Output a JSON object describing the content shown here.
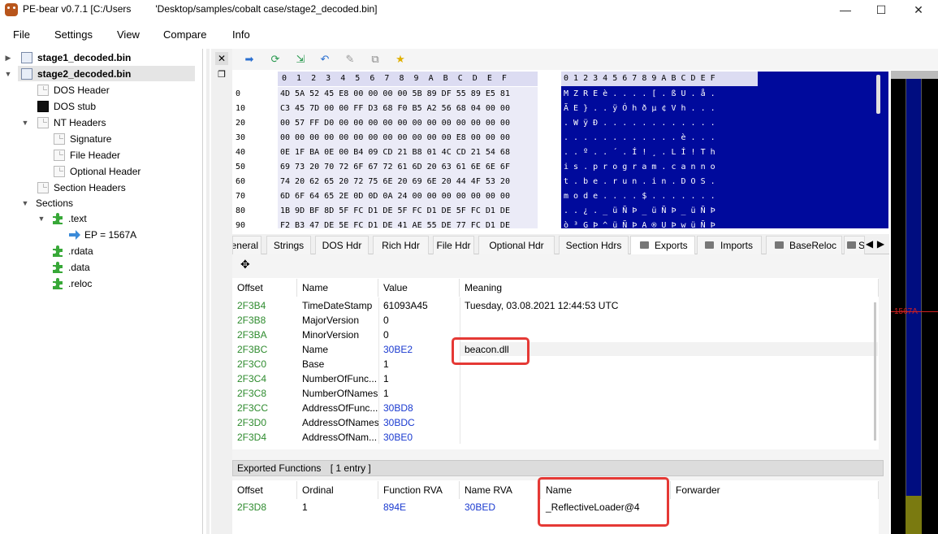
{
  "window": {
    "title": "PE-bear v0.7.1 [C:/Users         'Desktop/samples/cobalt case/stage2_decoded.bin]",
    "minimize": "—",
    "maximize": "☐",
    "close": "✕"
  },
  "menu": [
    "File",
    "Settings",
    "View",
    "Compare",
    "Info"
  ],
  "tree": {
    "files": [
      "stage1_decoded.bin",
      "stage2_decoded.bin"
    ],
    "nodes": [
      "DOS Header",
      "DOS stub",
      "NT Headers",
      "Signature",
      "File Header",
      "Optional Header",
      "Section Headers",
      "Sections",
      ".text",
      "EP = 1567A",
      ".rdata",
      ".data",
      ".reloc"
    ]
  },
  "hex": {
    "header": "0  1  2  3  4  5  6  7  8  9  A  B  C  D  E  F",
    "offsets": [
      "0",
      "10",
      "20",
      "30",
      "40",
      "50",
      "60",
      "70",
      "80",
      "90"
    ],
    "rows": [
      "4D 5A 52 45 E8 00 00 00 00 5B 89 DF 55 89 E5 81",
      "C3 45 7D 00 00 FF D3 68 F0 B5 A2 56 68 04 00 00",
      "00 57 FF D0 00 00 00 00 00 00 00 00 00 00 00 00",
      "00 00 00 00 00 00 00 00 00 00 00 00 E8 00 00 00",
      "0E 1F BA 0E 00 B4 09 CD 21 B8 01 4C CD 21 54 68",
      "69 73 20 70 72 6F 67 72 61 6D 20 63 61 6E 6E 6F",
      "74 20 62 65 20 72 75 6E 20 69 6E 20 44 4F 53 20",
      "6D 6F 64 65 2E 0D 0D 0A 24 00 00 00 00 00 00 00",
      "1B 9D BF 8D 5F FC D1 DE 5F FC D1 DE 5F FC D1 DE",
      "F2 B3 47 DE 5E FC D1 DE 41 AE 55 DE 77 FC D1 DE"
    ],
    "ascii_header": "0 1 2 3 4 5 6 7 8 9 A B C D E F",
    "ascii_rows": [
      "M Z R E è . . . . [ . ß U . å .",
      "Ã E } . . ÿ Ó h ð µ ¢ V h . . .",
      ". W ÿ Ð . . . . . . . . . . . .",
      ". . . . . . . . . . . . è . . .",
      ". . º . . ´ . Í ! ¸ . L Í ! T h",
      "i s . p r o g r a m . c a n n o",
      "t . b e . r u n . i n . D O S .",
      "m o d e . . . . $ . . . . . . .",
      ". . ¿ . _ ü Ñ Þ _ ü Ñ Þ _ ü Ñ Þ",
      "ò ³ G Þ ^ ü Ñ Þ A ® U Þ w ü Ñ Þ"
    ]
  },
  "rva_marker": "1567A",
  "tabs": [
    "General",
    "Strings",
    "DOS Hdr",
    "Rich Hdr",
    "File Hdr",
    "Optional Hdr",
    "Section Hdrs",
    "Exports",
    "Imports",
    "BaseReloc",
    "Sec"
  ],
  "exports_table": {
    "columns": [
      "Offset",
      "Name",
      "Value",
      "Meaning"
    ],
    "rows": [
      {
        "offset": "2F3B4",
        "name": "TimeDateStamp",
        "value": "61093A45",
        "meaning": "Tuesday, 03.08.2021 12:44:53 UTC"
      },
      {
        "offset": "2F3B8",
        "name": "MajorVersion",
        "value": "0",
        "meaning": ""
      },
      {
        "offset": "2F3BA",
        "name": "MinorVersion",
        "value": "0",
        "meaning": ""
      },
      {
        "offset": "2F3BC",
        "name": "Name",
        "value": "30BE2",
        "meaning": "beacon.dll"
      },
      {
        "offset": "2F3C0",
        "name": "Base",
        "value": "1",
        "meaning": ""
      },
      {
        "offset": "2F3C4",
        "name": "NumberOfFunc...",
        "value": "1",
        "meaning": ""
      },
      {
        "offset": "2F3C8",
        "name": "NumberOfNames",
        "value": "1",
        "meaning": ""
      },
      {
        "offset": "2F3CC",
        "name": "AddressOfFunc...",
        "value": "30BD8",
        "meaning": ""
      },
      {
        "offset": "2F3D0",
        "name": "AddressOfNames",
        "value": "30BDC",
        "meaning": ""
      },
      {
        "offset": "2F3D4",
        "name": "AddressOfNam...",
        "value": "30BE0",
        "meaning": ""
      }
    ]
  },
  "exported_functions": {
    "title": "Exported Functions",
    "count": "[ 1 entry ]",
    "columns": [
      "Offset",
      "Ordinal",
      "Function RVA",
      "Name RVA",
      "Name",
      "Forwarder"
    ],
    "rows": [
      {
        "offset": "2F3D8",
        "ordinal": "1",
        "function_rva": "894E",
        "name_rva": "30BED",
        "name": "_ReflectiveLoader@4",
        "forwarder": ""
      }
    ]
  },
  "colors": {
    "highlight_red": "#e53935",
    "offset_green": "#2e8b2e",
    "rva_blue": "#1a3ad0",
    "ascii_bg": "#000a9c"
  }
}
